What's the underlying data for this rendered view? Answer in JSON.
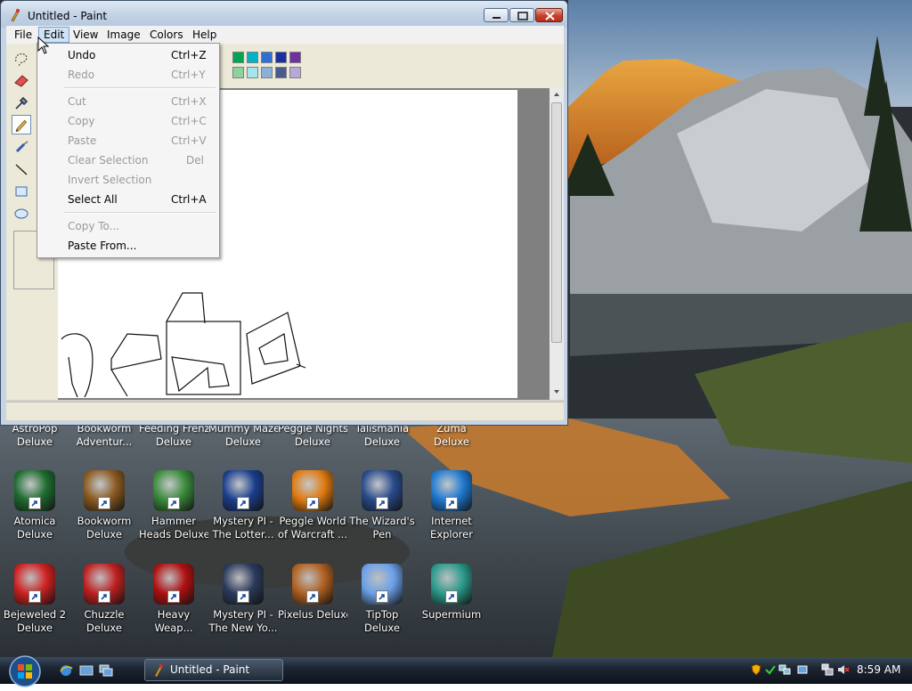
{
  "window": {
    "title": "Untitled - Paint",
    "menus": [
      "File",
      "Edit",
      "View",
      "Image",
      "Colors",
      "Help"
    ]
  },
  "edit_menu": {
    "items": [
      {
        "label": "Undo",
        "shortcut": "Ctrl+Z",
        "enabled": true
      },
      {
        "label": "Redo",
        "shortcut": "Ctrl+Y",
        "enabled": false
      },
      {
        "label": "Cut",
        "shortcut": "Ctrl+X",
        "enabled": false
      },
      {
        "label": "Copy",
        "shortcut": "Ctrl+C",
        "enabled": false
      },
      {
        "label": "Paste",
        "shortcut": "Ctrl+V",
        "enabled": false
      },
      {
        "label": "Clear Selection",
        "shortcut": "Del",
        "enabled": false
      },
      {
        "label": "Invert Selection",
        "shortcut": "",
        "enabled": false
      },
      {
        "label": "Select All",
        "shortcut": "Ctrl+A",
        "enabled": true
      },
      {
        "label": "Copy To...",
        "shortcut": "",
        "enabled": false
      },
      {
        "label": "Paste From...",
        "shortcut": "",
        "enabled": true
      }
    ]
  },
  "tools": [
    "free-select-icon",
    "eraser-icon",
    "eyedropper-icon",
    "pencil-icon",
    "brush-icon",
    "line-icon",
    "rectangle-icon",
    "ellipse-icon"
  ],
  "active_tool": "pencil-icon",
  "palette_colors": [
    "#00a651",
    "#00b4c8",
    "#2f6fd6",
    "#1c2fa0",
    "#7030a0",
    "#8fd19e",
    "#a6e4ee",
    "#8ab0d8",
    "#4a5a8c",
    "#b8a8d8"
  ],
  "partial_icon_row": [
    "AstroPop Deluxe",
    "Bookworm Adventur...",
    "Feeding Frenzy Deluxe",
    "Mummy Maze Deluxe",
    "Peggle Nights Deluxe",
    "Talismania Deluxe",
    "Zuma Deluxe"
  ],
  "desktop_icons_row2": [
    {
      "label1": "Atomica",
      "label2": "Deluxe"
    },
    {
      "label1": "Bookworm",
      "label2": "Deluxe"
    },
    {
      "label1": "Hammer",
      "label2": "Heads Deluxe"
    },
    {
      "label1": "Mystery PI -",
      "label2": "The Lotter..."
    },
    {
      "label1": "Peggle World",
      "label2": "of Warcraft ..."
    },
    {
      "label1": "The Wizard's",
      "label2": "Pen"
    },
    {
      "label1": "Internet",
      "label2": "Explorer"
    }
  ],
  "desktop_icons_row3": [
    {
      "label1": "Bejeweled 2",
      "label2": "Deluxe"
    },
    {
      "label1": "Chuzzle",
      "label2": "Deluxe"
    },
    {
      "label1": "Heavy",
      "label2": "Weap..."
    },
    {
      "label1": "Mystery PI -",
      "label2": "The New Yo..."
    },
    {
      "label1": "Pixelus Deluxe",
      "label2": ""
    },
    {
      "label1": "TipTop",
      "label2": "Deluxe"
    },
    {
      "label1": "Supermium",
      "label2": ""
    }
  ],
  "taskbar": {
    "task_label": "Untitled - Paint",
    "clock": "8:59 AM"
  },
  "colors": {
    "titlebar": "#c3d3e6",
    "menu_highlight": "#cfe3f6",
    "taskbar": "#1c2532"
  }
}
